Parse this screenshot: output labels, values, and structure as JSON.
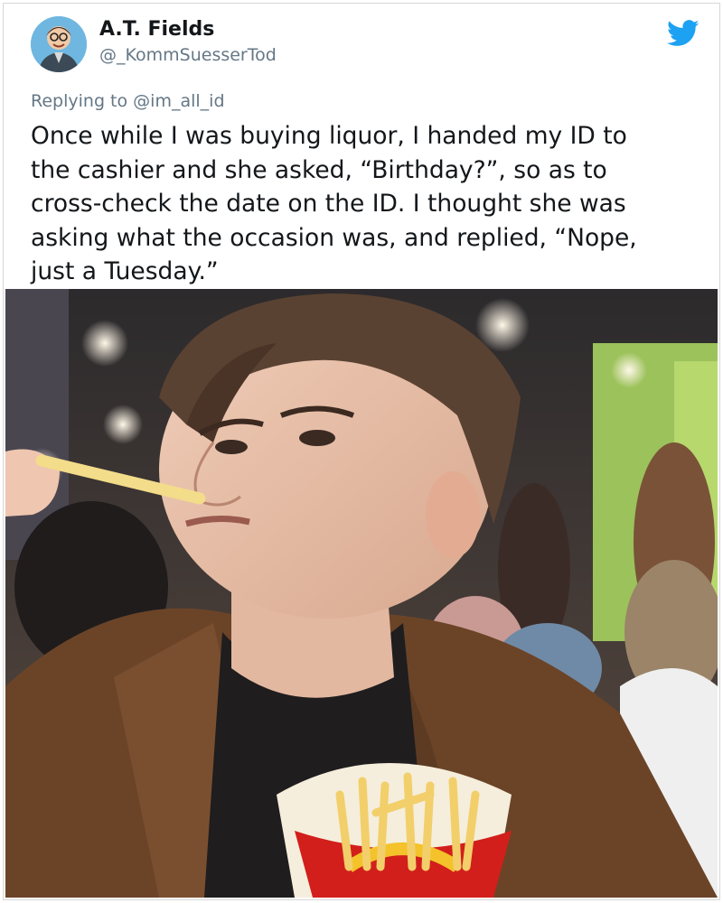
{
  "tweet": {
    "author_name": "A.T. Fields",
    "author_handle": "@_KommSuesserTod",
    "replying_prefix": "Replying to",
    "replying_to": "@im_all_id",
    "text_lines": [
      "Once while I was buying liquor, I handed my ID to",
      "the cashier and she asked, “Birthday?”, so as to",
      "cross-check the date on the ID. I thought she was",
      "asking what the occasion was, and replied, “Nope,",
      "just a Tuesday.”"
    ]
  },
  "icons": {
    "platform_logo": "twitter-bird-icon"
  },
  "colors": {
    "brand_blue": "#1da1f2",
    "secondary_text": "#657786",
    "primary_text": "#14171a"
  }
}
